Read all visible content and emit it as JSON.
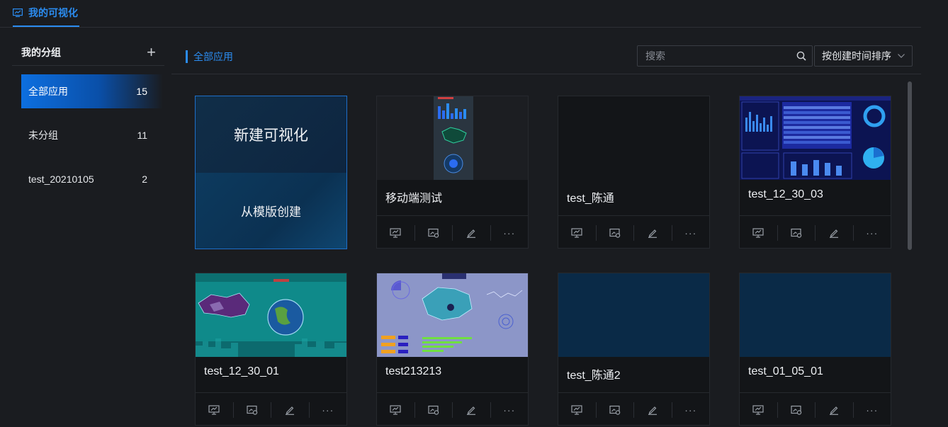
{
  "top_tab": {
    "label": "我的可视化"
  },
  "sidebar": {
    "title": "我的分组",
    "add_icon": "plus-icon",
    "items": [
      {
        "label": "全部应用",
        "count": "15"
      },
      {
        "label": "未分组",
        "count": "11"
      },
      {
        "label": "test_20210105",
        "count": "2"
      }
    ]
  },
  "main": {
    "crumb": "全部应用",
    "search_placeholder": "搜索",
    "sort_label": "按创建时间排序",
    "new_card": {
      "create": "新建可视化",
      "from_template": "从模版创建"
    },
    "cards": [
      {
        "name": "移动端测试",
        "thumb": "mobile"
      },
      {
        "name": "test_陈通",
        "thumb": "empty"
      },
      {
        "name": "test_12_30_03",
        "thumb": "dashboard"
      },
      {
        "name": "test_12_30_01",
        "thumb": "globe"
      },
      {
        "name": "test213213",
        "thumb": "map-light"
      },
      {
        "name": "test_陈通2",
        "thumb": "blue"
      },
      {
        "name": "test_01_05_01",
        "thumb": "blue"
      }
    ],
    "action_icons": [
      "preview-icon",
      "publish-icon",
      "edit-icon",
      "more-icon"
    ]
  },
  "colors": {
    "accent": "#2b8cf0",
    "background": "#1a1c20",
    "card": "#131518"
  }
}
